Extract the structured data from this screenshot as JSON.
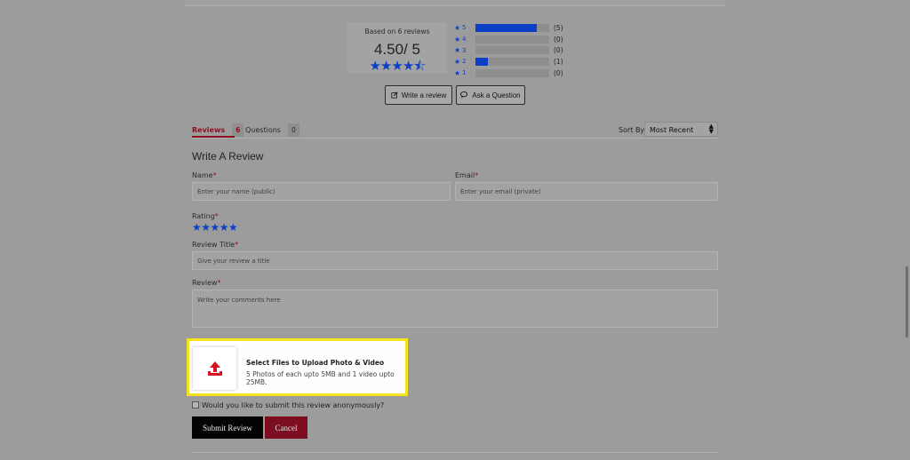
{
  "summary": {
    "based_on": "Based on 6 reviews",
    "average": "4.50/ 5",
    "stars": "★★★★",
    "half_star": "⯪"
  },
  "rating_bars": [
    {
      "star": "5",
      "count": "(5)",
      "fraction": 0.83
    },
    {
      "star": "4",
      "count": "(0)",
      "fraction": 0
    },
    {
      "star": "3",
      "count": "(0)",
      "fraction": 0
    },
    {
      "star": "2",
      "count": "(1)",
      "fraction": 0.17
    },
    {
      "star": "1",
      "count": "(0)",
      "fraction": 0
    }
  ],
  "actions": {
    "write_review": "Write a review",
    "ask_question": "Ask a Question"
  },
  "tabs": [
    {
      "label": "Reviews",
      "count": "6"
    },
    {
      "label": "Questions",
      "count": "0"
    }
  ],
  "sort": {
    "label": "Sort By:",
    "selected": "Most Recent"
  },
  "form": {
    "title": "Write A Review",
    "name_label": "Name",
    "name_placeholder": "Enter your name (public)",
    "email_label": "Email",
    "email_placeholder": "Enter your email (private)",
    "rating_label": "Rating",
    "rating_stars": "★★★★★",
    "review_title_label": "Review Title",
    "review_title_placeholder": "Give your review a title",
    "review_label": "Review",
    "review_placeholder": "Write your comments here",
    "required_mark": "*"
  },
  "upload": {
    "title": "Select Files to Upload Photo & Video",
    "subtitle": "5 Photos of each upto 5MB and 1 video upto 25MB."
  },
  "anonymous": {
    "label": "Would you like to submit this review anonymously?"
  },
  "buttons": {
    "submit": "Submit Review",
    "cancel": "Cancel"
  },
  "colors": {
    "accent_blue": "#0b3fc6",
    "accent_red": "#8e0f1f",
    "highlight_yellow": "#f3e31c"
  }
}
